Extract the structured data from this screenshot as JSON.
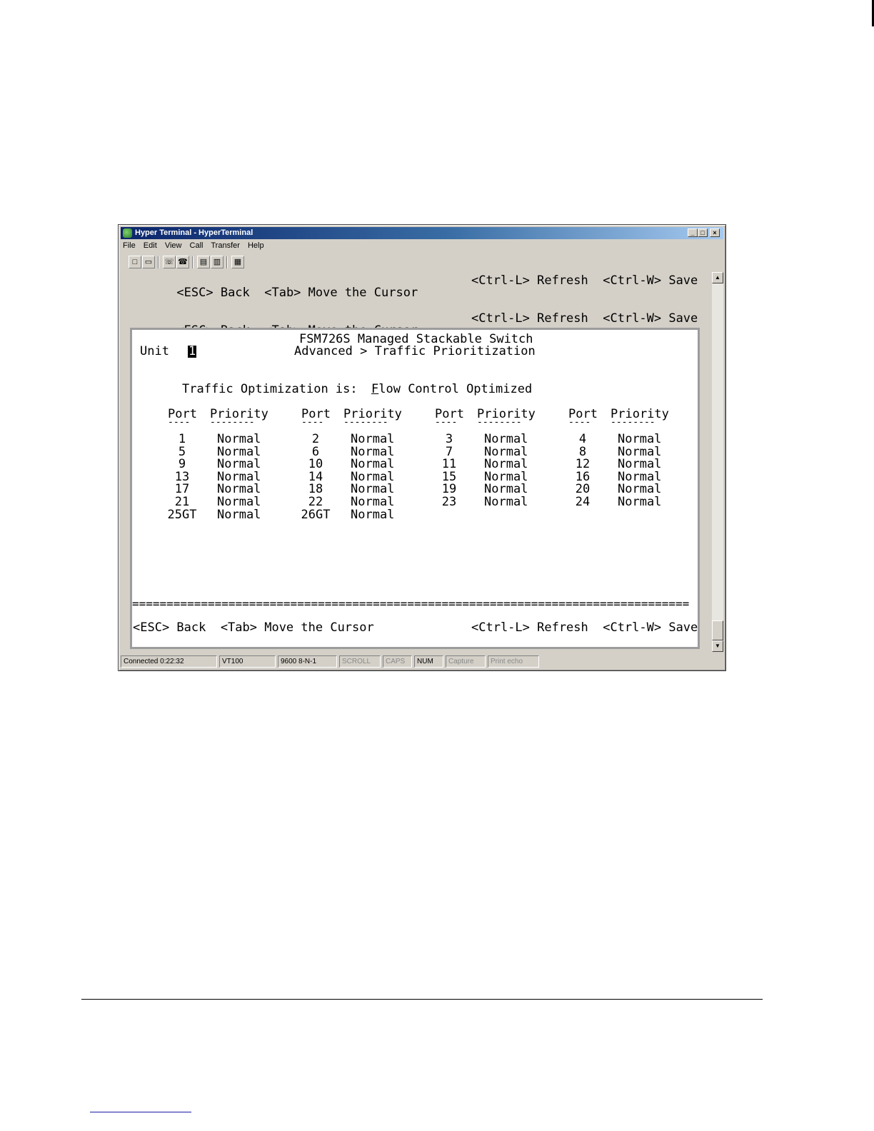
{
  "window": {
    "title": "Hyper Terminal - HyperTerminal",
    "controls": [
      "_",
      "□",
      "×"
    ]
  },
  "menu": [
    "File",
    "Edit",
    "View",
    "Call",
    "Transfer",
    "Help"
  ],
  "toolbar_icons": [
    "new-icon",
    "open-icon",
    "disconnect-icon",
    "connect-icon",
    "send-icon",
    "receive-icon",
    "properties-icon"
  ],
  "keys": {
    "left": "<ESC> Back  <Tab> Move the Cursor",
    "right": "<Ctrl-L> Refresh  <Ctrl-W> Save"
  },
  "screen": {
    "title": "FSM726S Managed Stackable Switch",
    "breadcrumb": "Advanced > Traffic Prioritization",
    "unit_label": "Unit",
    "unit_value": "1",
    "optimization_label": "Traffic Optimization is:",
    "optimization_first": "F",
    "optimization_rest": "low Control Optimized",
    "col_port": "Port",
    "col_priority": "Priority",
    "port_underline": "----",
    "priority_underline": "--------",
    "separator": "=================================================================================",
    "rows": [
      [
        {
          "port": "1",
          "priority": "Normal"
        },
        {
          "port": "2",
          "priority": "Normal"
        },
        {
          "port": "3",
          "priority": "Normal"
        },
        {
          "port": "4",
          "priority": "Normal"
        }
      ],
      [
        {
          "port": "5",
          "priority": "Normal"
        },
        {
          "port": "6",
          "priority": "Normal"
        },
        {
          "port": "7",
          "priority": "Normal"
        },
        {
          "port": "8",
          "priority": "Normal"
        }
      ],
      [
        {
          "port": "9",
          "priority": "Normal"
        },
        {
          "port": "10",
          "priority": "Normal"
        },
        {
          "port": "11",
          "priority": "Normal"
        },
        {
          "port": "12",
          "priority": "Normal"
        }
      ],
      [
        {
          "port": "13",
          "priority": "Normal"
        },
        {
          "port": "14",
          "priority": "Normal"
        },
        {
          "port": "15",
          "priority": "Normal"
        },
        {
          "port": "16",
          "priority": "Normal"
        }
      ],
      [
        {
          "port": "17",
          "priority": "Normal"
        },
        {
          "port": "18",
          "priority": "Normal"
        },
        {
          "port": "19",
          "priority": "Normal"
        },
        {
          "port": "20",
          "priority": "Normal"
        }
      ],
      [
        {
          "port": "21",
          "priority": "Normal"
        },
        {
          "port": "22",
          "priority": "Normal"
        },
        {
          "port": "23",
          "priority": "Normal"
        },
        {
          "port": "24",
          "priority": "Normal"
        }
      ],
      [
        {
          "port": "25GT",
          "priority": "Normal"
        },
        {
          "port": "26GT",
          "priority": "Normal"
        }
      ]
    ]
  },
  "status": [
    "Connected 0:22:32",
    "VT100",
    "9600 8-N-1",
    "SCROLL",
    "CAPS",
    "NUM",
    "Capture",
    "Print echo"
  ]
}
